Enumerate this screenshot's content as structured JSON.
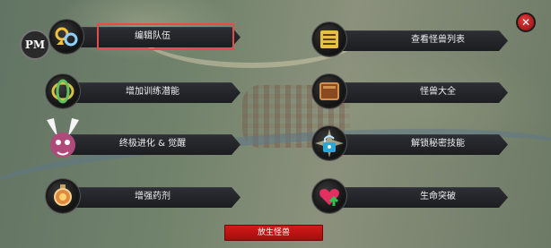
{
  "header": {
    "pm_badge": "PM",
    "close_glyph": "✕"
  },
  "left_menu": [
    {
      "label": "编辑队伍",
      "icon": "gear-swap-icon"
    },
    {
      "label": "增加训练潜能",
      "icon": "hoops-icon"
    },
    {
      "label": "终极进化 & 觉醒",
      "icon": "monster-icon"
    },
    {
      "label": "增强药剂",
      "icon": "potion-icon"
    }
  ],
  "right_menu": [
    {
      "label": "查看怪兽列表",
      "icon": "list-icon"
    },
    {
      "label": "怪兽大全",
      "icon": "book-icon"
    },
    {
      "label": "解锁秘密技能",
      "icon": "lock-icon"
    },
    {
      "label": "生命突破",
      "icon": "heart-up-icon"
    }
  ],
  "release_button": {
    "label": "放生怪兽"
  },
  "colors": {
    "highlight": "#e44b4b",
    "button_red": "#d21a1a",
    "bar_dark": "#2d2e33"
  }
}
